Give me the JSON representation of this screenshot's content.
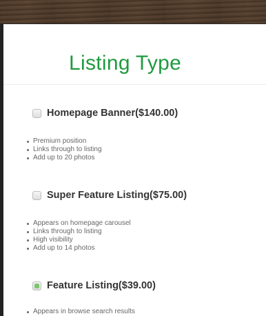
{
  "modal": {
    "title": "Listing Type",
    "options": [
      {
        "label": "Homepage Banner($140.00)",
        "selected": false,
        "features": [
          "Premium position",
          "Links through to listing",
          "Add up to 20 photos"
        ]
      },
      {
        "label": "Super Feature Listing($75.00)",
        "selected": false,
        "features": [
          "Appears on homepage carousel",
          "Links through to listing",
          "High visibility",
          "Add up to 14 photos"
        ]
      },
      {
        "label": "Feature Listing($39.00)",
        "selected": true,
        "features": [
          "Appears in browse search results"
        ]
      }
    ]
  },
  "colors": {
    "title": "#1f9a3f",
    "selected_radio": "#7bc86c"
  }
}
